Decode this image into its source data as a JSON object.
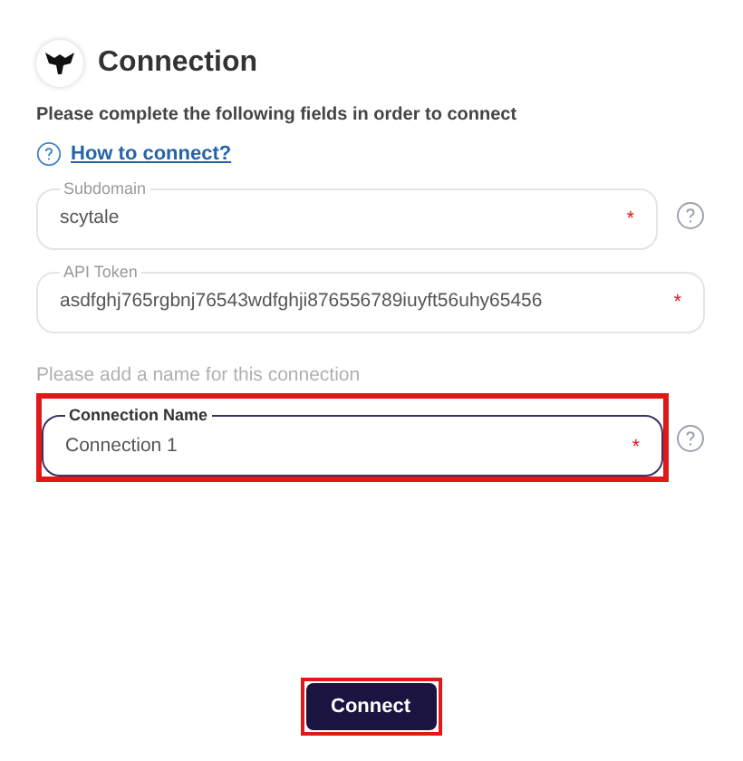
{
  "header": {
    "title": "Connection",
    "subtitle": "Please complete the following fields in order to connect",
    "help_link": "How to connect?"
  },
  "fields": [
    {
      "label": "Subdomain",
      "value": "scytale",
      "required_mark": "*",
      "help": true,
      "focused": false,
      "highlighted": false
    },
    {
      "label": "API Token",
      "value": "asdfghj765rgbnj76543wdfghji876556789iuyft56uhy65456",
      "required_mark": "*",
      "help": false,
      "focused": false,
      "highlighted": false
    },
    {
      "hint": "Please add a name for this connection",
      "label": "Connection Name",
      "value": "Connection 1",
      "required_mark": "*",
      "help": true,
      "focused": true,
      "highlighted": true
    }
  ],
  "button": {
    "label": "Connect",
    "highlighted": true
  }
}
